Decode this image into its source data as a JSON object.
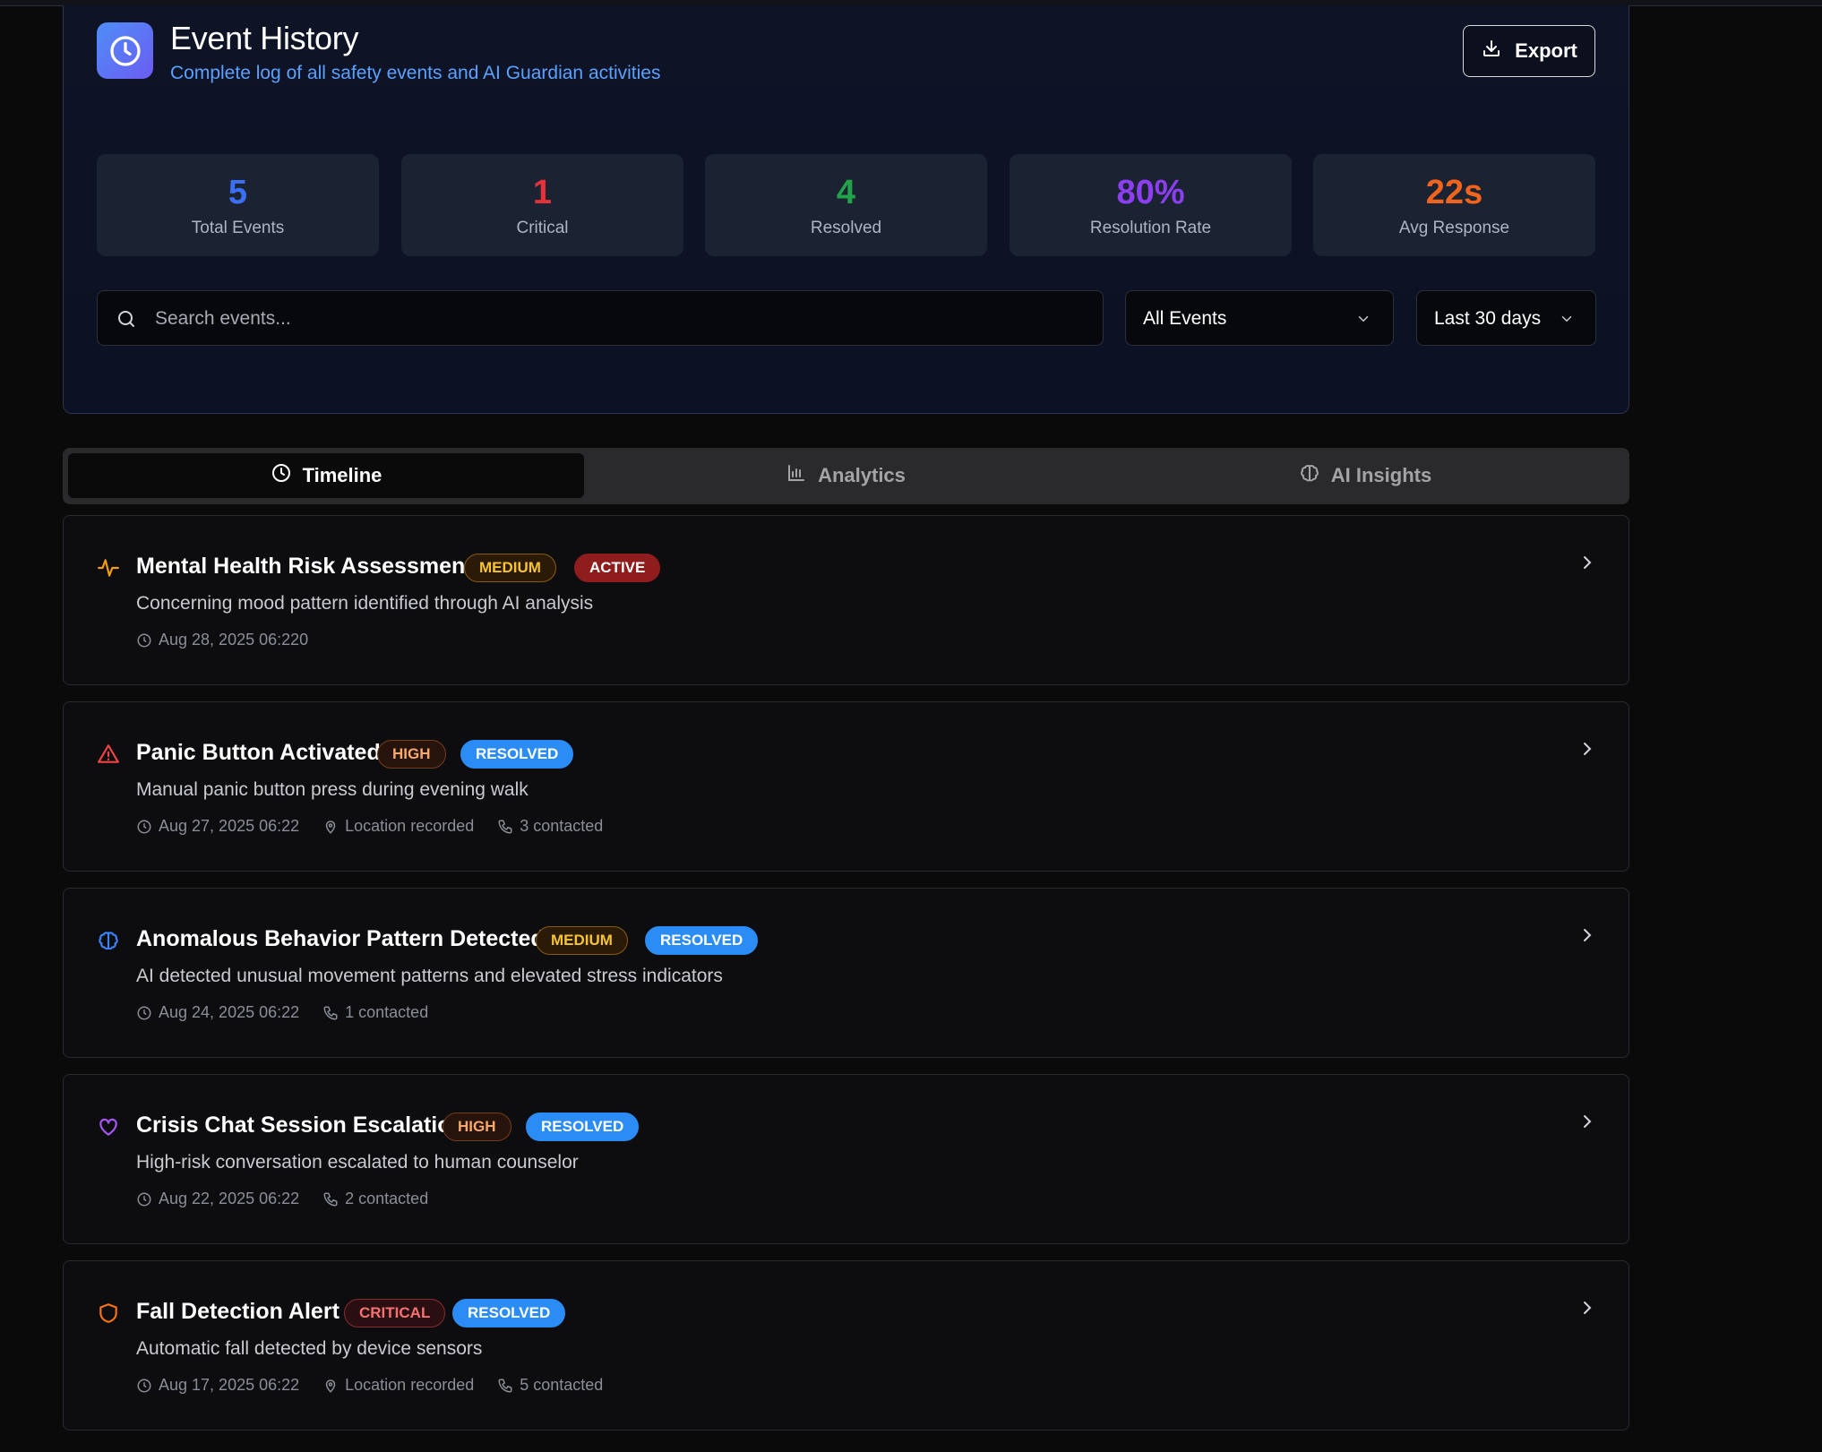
{
  "header": {
    "title": "Event History",
    "subtitle": "Complete log of all safety events and AI Guardian activities",
    "export_label": "Export"
  },
  "stats": [
    {
      "value": "5",
      "label": "Total Events",
      "color": "#3b6ff5"
    },
    {
      "value": "1",
      "label": "Critical",
      "color": "#e5323a"
    },
    {
      "value": "4",
      "label": "Resolved",
      "color": "#22a34a"
    },
    {
      "value": "80%",
      "label": "Resolution Rate",
      "color": "#8b3ff0"
    },
    {
      "value": "22s",
      "label": "Avg Response",
      "color": "#f0641e"
    }
  ],
  "filters": {
    "search_placeholder": "Search events...",
    "type_value": "All Events",
    "range_value": "Last 30 days"
  },
  "tabs": [
    {
      "label": "Timeline",
      "icon": "clock-icon",
      "active": true
    },
    {
      "label": "Analytics",
      "icon": "bar-chart-icon",
      "active": false
    },
    {
      "label": "AI Insights",
      "icon": "brain-icon",
      "active": false
    }
  ],
  "events": [
    {
      "title": "Mental Health Risk Assessment",
      "icon": "activity-icon",
      "icon_color": "#f59e0b",
      "severity": "MEDIUM",
      "status": "ACTIVE",
      "description": "Concerning mood pattern identified through AI analysis",
      "date": "Aug 28, 2025 06:220",
      "location": null,
      "contacted": null
    },
    {
      "title": "Panic Button Activated",
      "icon": "alert-triangle-icon",
      "icon_color": "#ef4444",
      "severity": "HIGH",
      "status": "RESOLVED",
      "description": "Manual panic button press during evening walk",
      "date": "Aug 27, 2025 06:22",
      "location": "Location recorded",
      "contacted": "3 contacted"
    },
    {
      "title": "Anomalous Behavior Pattern Detected",
      "icon": "brain-icon",
      "icon_color": "#3b82f6",
      "severity": "MEDIUM",
      "status": "RESOLVED",
      "description": "AI detected unusual movement patterns and elevated stress indicators",
      "date": "Aug 24, 2025 06:22",
      "location": null,
      "contacted": "1 contacted"
    },
    {
      "title": "Crisis Chat Session Escalation",
      "icon": "heart-icon",
      "icon_color": "#a855f7",
      "severity": "HIGH",
      "status": "RESOLVED",
      "description": "High-risk conversation escalated to human counselor",
      "date": "Aug 22, 2025 06:22",
      "location": null,
      "contacted": "2 contacted"
    },
    {
      "title": "Fall Detection Alert",
      "icon": "shield-icon",
      "icon_color": "#f97316",
      "severity": "CRITICAL",
      "status": "RESOLVED",
      "description": "Automatic fall detected by device sensors",
      "date": "Aug 17, 2025 06:22",
      "location": "Location recorded",
      "contacted": "5 contacted"
    }
  ]
}
